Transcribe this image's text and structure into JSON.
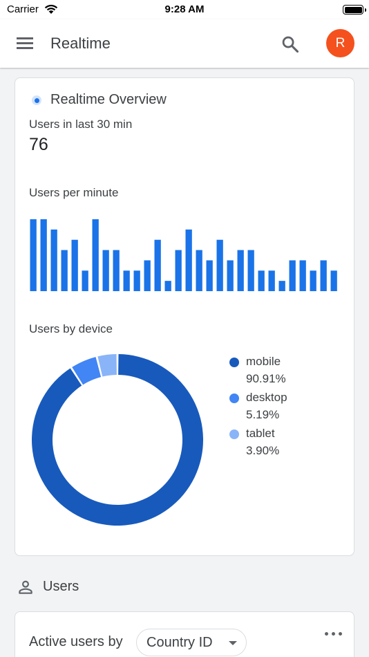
{
  "status_bar": {
    "carrier": "Carrier",
    "time": "9:28 AM"
  },
  "app_bar": {
    "title": "Realtime",
    "avatar_letter": "R",
    "avatar_color": "#f4511e"
  },
  "overview": {
    "title": "Realtime Overview",
    "users_30min_label": "Users in last 30 min",
    "users_30min_value": "76",
    "per_minute_label": "Users per minute",
    "device_label": "Users by device"
  },
  "chart_data": [
    {
      "type": "bar",
      "title": "Users per minute",
      "values": [
        7,
        7,
        6,
        4,
        5,
        2,
        7,
        4,
        4,
        2,
        2,
        3,
        5,
        1,
        4,
        6,
        4,
        3,
        5,
        3,
        4,
        4,
        2,
        2,
        1,
        3,
        3,
        2,
        3,
        2
      ],
      "ylim": [
        0,
        7
      ],
      "color": "#1a73e8",
      "grid": false
    },
    {
      "type": "pie",
      "title": "Users by device",
      "donut": true,
      "slices": [
        {
          "name": "mobile",
          "value": 90.91,
          "label": "90.91%",
          "color": "#185abc"
        },
        {
          "name": "desktop",
          "value": 5.19,
          "label": "5.19%",
          "color": "#4285f4"
        },
        {
          "name": "tablet",
          "value": 3.9,
          "label": "3.90%",
          "color": "#8ab4f8"
        }
      ],
      "legend": "right"
    }
  ],
  "users_section": {
    "label": "Users",
    "icon": "person-icon"
  },
  "active_users": {
    "label": "Active users by",
    "selected_dimension": "Country ID"
  }
}
